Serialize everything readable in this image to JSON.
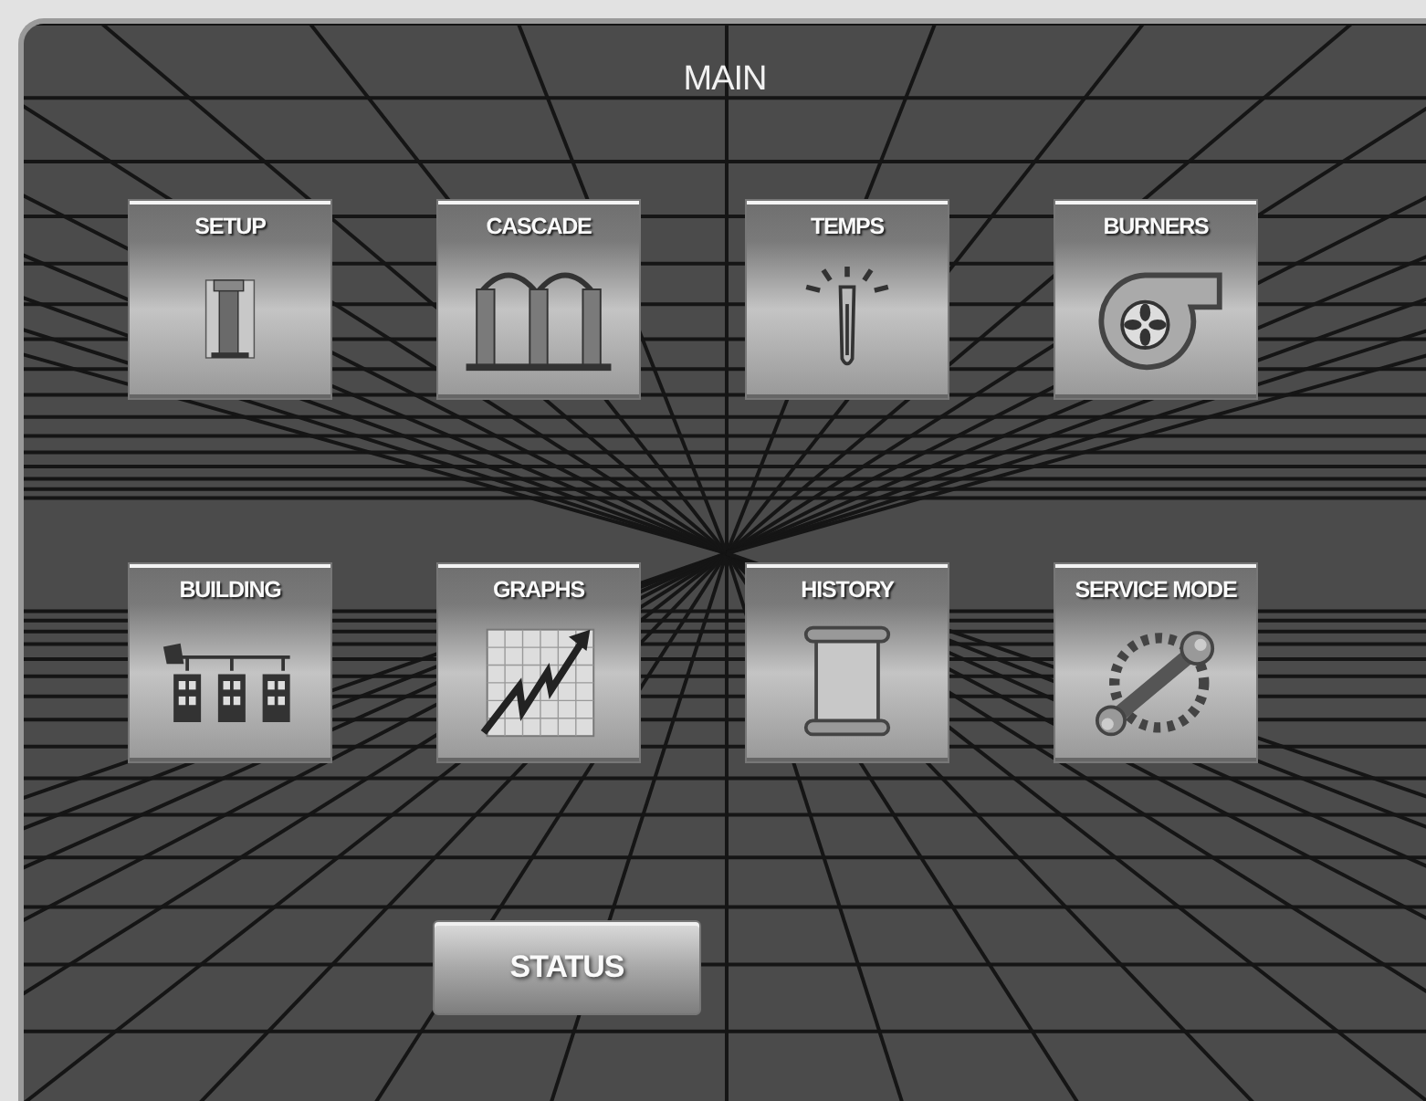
{
  "screen": {
    "title": "MAIN"
  },
  "tiles": [
    {
      "label": "SETUP",
      "kind": "setup"
    },
    {
      "label": "CASCADE",
      "kind": "cascade"
    },
    {
      "label": "TEMPS",
      "kind": "temps"
    },
    {
      "label": "BURNERS",
      "kind": "burners"
    },
    {
      "label": "BUILDING",
      "kind": "building"
    },
    {
      "label": "GRAPHS",
      "kind": "graphs"
    },
    {
      "label": "HISTORY",
      "kind": "history"
    },
    {
      "label": "SERVICE MODE",
      "kind": "service"
    }
  ],
  "status_button": {
    "label": "STATUS"
  }
}
